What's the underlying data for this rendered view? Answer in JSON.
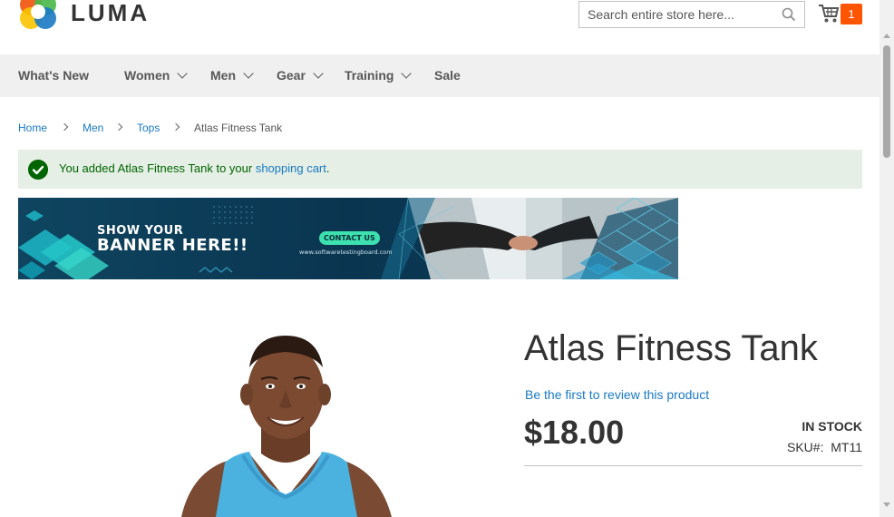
{
  "brand": {
    "name": "LUMA"
  },
  "search": {
    "placeholder": "Search entire store here..."
  },
  "cart": {
    "count": "1"
  },
  "nav": {
    "items": [
      {
        "label": "What's New",
        "has_menu": false
      },
      {
        "label": "Women",
        "has_menu": true
      },
      {
        "label": "Men",
        "has_menu": true
      },
      {
        "label": "Gear",
        "has_menu": true
      },
      {
        "label": "Training",
        "has_menu": true
      },
      {
        "label": "Sale",
        "has_menu": false
      }
    ]
  },
  "breadcrumb": {
    "links": [
      "Home",
      "Men",
      "Tops"
    ],
    "current": "Atlas Fitness Tank"
  },
  "message": {
    "text_before": "You added Atlas Fitness Tank to your ",
    "link": "shopping cart",
    "text_after": "."
  },
  "banner": {
    "line1": "SHOW YOUR",
    "line2": "BANNER HERE!!",
    "button": "CONTACT US",
    "url": "www.softwaretestingboard.com"
  },
  "product": {
    "title": "Atlas Fitness Tank",
    "review_link": "Be the first to review this product",
    "price": "$18.00",
    "stock": "In stock",
    "sku_label": "SKU#:",
    "sku": "MT11"
  },
  "colors": {
    "accent": "#1979c3",
    "cart_badge": "#ff5501",
    "success_bg": "#e5efe5",
    "success_text": "#006400",
    "nav_bg": "#f0f0f0"
  }
}
